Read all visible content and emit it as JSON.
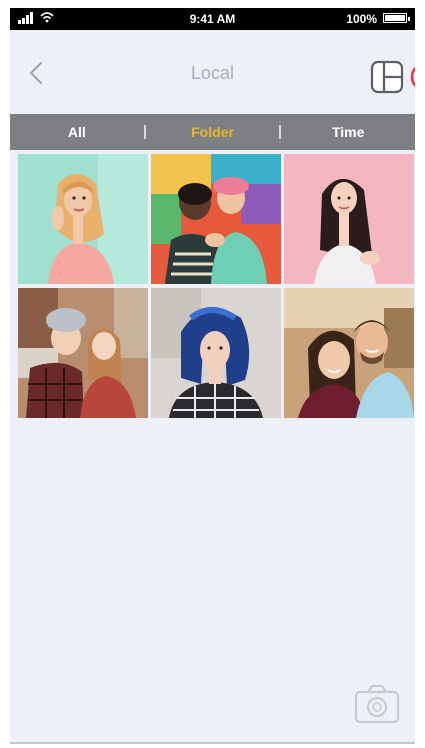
{
  "status_bar": {
    "time": "9:41 AM",
    "battery": "100%"
  },
  "nav": {
    "title": "Local",
    "back_icon": "chevron-left-icon",
    "layout_icon": "collage-layout-icon",
    "print_icon": "red-circle-icon",
    "accent_color": "#e8323c"
  },
  "tabs": [
    {
      "label": "All",
      "active": false
    },
    {
      "label": "Folder",
      "active": true
    },
    {
      "label": "Time",
      "active": false
    }
  ],
  "tab_colors": {
    "bar": "#7d7f83",
    "active": "#e6b82a",
    "inactive": "#ffffff"
  },
  "photos": [
    {
      "name": "photo-woman-mint-background"
    },
    {
      "name": "photo-couple-graffiti-wall"
    },
    {
      "name": "photo-woman-pink-background"
    },
    {
      "name": "photo-friends-beanie-selfie"
    },
    {
      "name": "photo-woman-blue-hair"
    },
    {
      "name": "photo-couple-smiling-selfie"
    }
  ],
  "footer": {
    "camera_icon": "camera-icon"
  }
}
